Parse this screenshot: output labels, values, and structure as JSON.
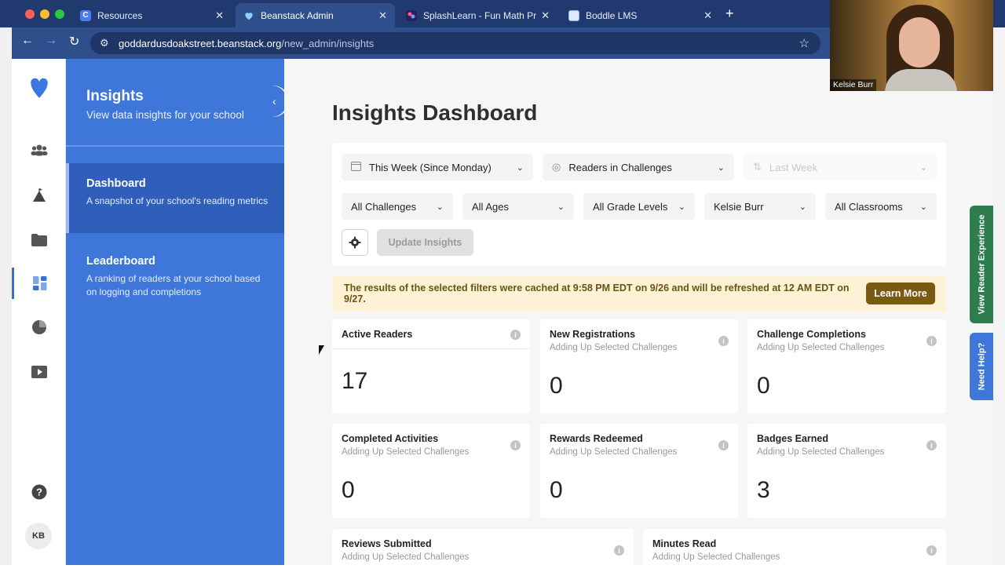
{
  "browser": {
    "tabs": [
      {
        "title": "Resources",
        "icon": "C",
        "color": "#4a7cf0"
      },
      {
        "title": "Beanstack Admin",
        "icon": "heart",
        "color": "#6fb6ff"
      },
      {
        "title": "SplashLearn - Fun Math Practi",
        "icon": "splash",
        "color": "#6b4bd6"
      },
      {
        "title": "Boddle LMS",
        "icon": "boddle",
        "color": "#4a7cf0"
      }
    ],
    "new_tab": "+",
    "close_glyph": "✕",
    "url_host": "goddardusdoakstreet.beanstack.org",
    "url_path": "/new_admin/insights"
  },
  "sidebar_panel": {
    "title": "Insights",
    "subtitle": "View data insights for your school",
    "items": [
      {
        "title": "Dashboard",
        "description": "A snapshot of your school's reading metrics"
      },
      {
        "title": "Leaderboard",
        "description": "A ranking of readers at your school based on logging and completions"
      }
    ]
  },
  "rail": {
    "avatar_initials": "KB"
  },
  "main": {
    "page_title": "Insights Dashboard",
    "filters": {
      "row1": [
        "This Week (Since Monday)",
        "Readers in Challenges",
        "Last Week"
      ],
      "row2": [
        "All Challenges",
        "All Ages",
        "All Grade Levels",
        "Kelsie Burr",
        "All Classrooms"
      ],
      "update_label": "Update Insights"
    },
    "notice": {
      "text": "The results of the selected filters were cached at 9:58 PM EDT on 9/26 and will be refreshed at 12 AM EDT on 9/27.",
      "button": "Learn More"
    },
    "cards": [
      {
        "title": "Active Readers",
        "subtitle": "",
        "value": "17"
      },
      {
        "title": "New Registrations",
        "subtitle": "Adding Up Selected Challenges",
        "value": "0"
      },
      {
        "title": "Challenge Completions",
        "subtitle": "Adding Up Selected Challenges",
        "value": "0"
      },
      {
        "title": "Completed Activities",
        "subtitle": "Adding Up Selected Challenges",
        "value": "0"
      },
      {
        "title": "Rewards Redeemed",
        "subtitle": "Adding Up Selected Challenges",
        "value": "0"
      },
      {
        "title": "Badges Earned",
        "subtitle": "Adding Up Selected Challenges",
        "value": "3"
      },
      {
        "title": "Reviews Submitted",
        "subtitle": "Adding Up Selected Challenges",
        "value": ""
      },
      {
        "title": "Minutes Read",
        "subtitle": "Adding Up Selected Challenges",
        "value": ""
      }
    ]
  },
  "side_tabs": {
    "experience": "View Reader Experience",
    "help": "Need Help?"
  },
  "webcam": {
    "name": "Kelsie Burr"
  },
  "colors": {
    "brand_blue": "#3f76d9",
    "side_green": "#2e7d4f",
    "side_blue": "#3f76d9",
    "notice_bg": "#fdf1d6",
    "learn_btn": "#7a5a12"
  }
}
